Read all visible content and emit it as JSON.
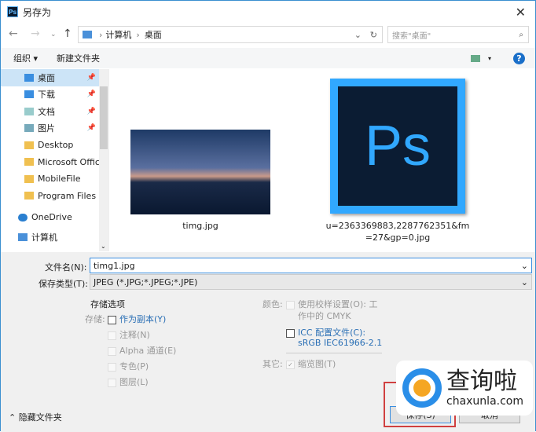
{
  "title": "另存为",
  "nav": {
    "path": [
      "计算机",
      "桌面"
    ],
    "search_placeholder": "搜索\"桌面\""
  },
  "toolbar": {
    "organize": "组织 ▾",
    "new_folder": "新建文件夹"
  },
  "sidebar": {
    "items": [
      {
        "label": "桌面",
        "pinned": true
      },
      {
        "label": "下载",
        "pinned": true
      },
      {
        "label": "文档",
        "pinned": true
      },
      {
        "label": "图片",
        "pinned": true
      },
      {
        "label": "Desktop"
      },
      {
        "label": "Microsoft Offic"
      },
      {
        "label": "MobileFile"
      },
      {
        "label": "Program Files"
      },
      {
        "label": "OneDrive"
      },
      {
        "label": "计算机"
      }
    ]
  },
  "files": [
    {
      "name": "timg.jpg"
    },
    {
      "name": "u=2363369883,2287762351&fm=27&gp=0.jpg",
      "thumb_text": "Ps"
    }
  ],
  "form": {
    "filename_label": "文件名(N):",
    "filename": "timg1.jpg",
    "type_label": "保存类型(T):",
    "type": "JPEG (*.JPG;*.JPEG;*.JPE)"
  },
  "options": {
    "header": "存储选项",
    "save_label": "存储:",
    "as_copy": "作为副本(Y)",
    "notes": "注释(N)",
    "alpha": "Alpha 通道(E)",
    "spot": "专色(P)",
    "layers": "图层(L)",
    "color_label": "颜色:",
    "proof": "使用校样设置(O): 工",
    "proof2": "作中的 CMYK",
    "icc": "ICC 配置文件(C):",
    "icc2": "sRGB IEC61966-2.1",
    "other_label": "其它:",
    "thumbnail": "缩览图(T)"
  },
  "footer": {
    "hide_folders": "隐藏文件夹",
    "save": "保存(S)",
    "cancel": "取消"
  },
  "watermark": {
    "text": "查询啦",
    "url": "chaxunla.com"
  }
}
